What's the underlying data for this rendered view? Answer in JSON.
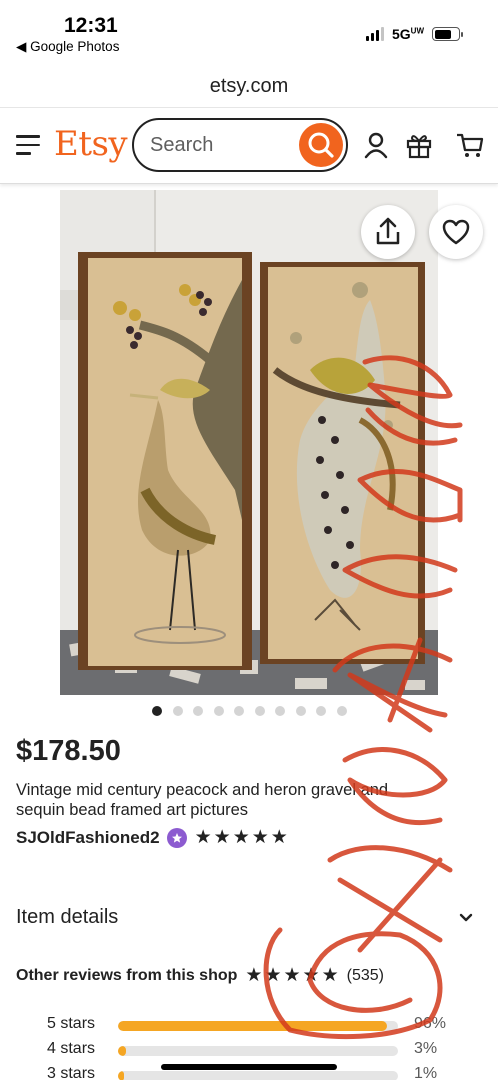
{
  "status_bar": {
    "time": "12:31",
    "back_app": "◀ Google Photos",
    "network": "5G"
  },
  "browser": {
    "url": "etsy.com"
  },
  "header": {
    "logo": "Etsy",
    "search_placeholder": "Search"
  },
  "product": {
    "image_count": 10,
    "active_image_index": 0,
    "price": "$178.50",
    "title": "Vintage mid century peacock and heron gravel and sequin bead framed art pictures",
    "shop_name": "SJOldFashioned2",
    "shop_rating_stars": 5
  },
  "sections": {
    "item_details": "Item details"
  },
  "reviews": {
    "label": "Other reviews from this shop",
    "stars": 5,
    "count": "(535)",
    "breakdown": [
      {
        "label": "5 stars",
        "percent": "96%",
        "fraction": 0.96
      },
      {
        "label": "4 stars",
        "percent": "3%",
        "fraction": 0.03
      },
      {
        "label": "3 stars",
        "percent": "1%",
        "fraction": 0.01
      }
    ]
  },
  "colors": {
    "brand": "#f1641e",
    "rating_bar": "#f5a623",
    "star_seller": "#8c5bd0",
    "watermark": "#d23a1c"
  },
  "icons": [
    "hamburger-menu-icon",
    "search-icon",
    "account-icon",
    "gift-icon",
    "cart-icon",
    "share-icon",
    "heart-icon",
    "chevron-down-icon",
    "star-seller-icon"
  ],
  "overlay": {
    "handwritten_watermark": "EXAMPLE"
  }
}
